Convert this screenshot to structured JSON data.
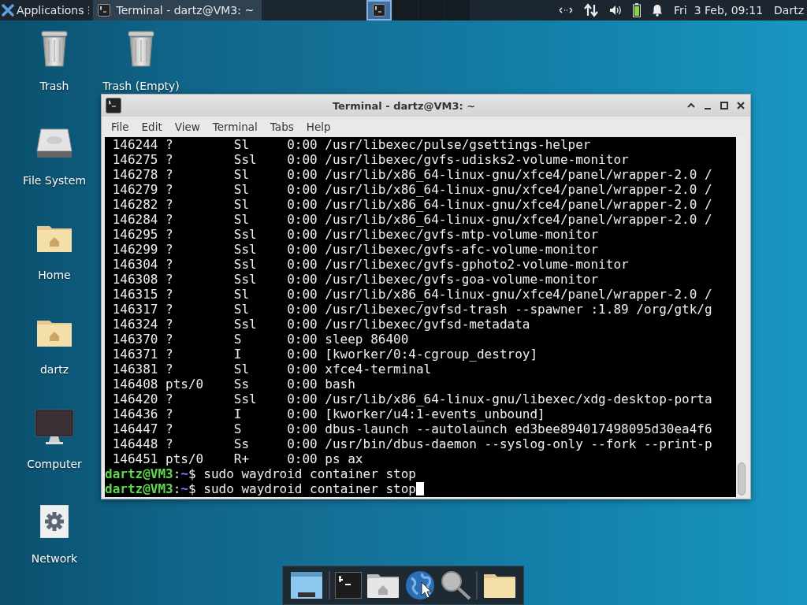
{
  "top_panel": {
    "applications_label": "Applications",
    "tasks": [
      {
        "title": "Terminal - dartz@VM3: ~",
        "selected": true
      }
    ],
    "workspaces": [
      {
        "selected": true
      },
      {
        "selected": false
      },
      {
        "selected": false
      },
      {
        "selected": false
      }
    ],
    "clock": "Fri  3 Feb, 09:11",
    "user": "Dartz"
  },
  "desktop_icons": [
    {
      "label": "Trash",
      "kind": "trash"
    },
    {
      "label": "Trash (Empty)",
      "kind": "trash"
    },
    {
      "label": "File System",
      "kind": "drive"
    },
    {
      "label": "Home",
      "kind": "home-folder"
    },
    {
      "label": "dartz",
      "kind": "home-folder"
    },
    {
      "label": "Computer",
      "kind": "monitor"
    },
    {
      "label": "Network",
      "kind": "gear"
    }
  ],
  "window": {
    "title": "Terminal - dartz@VM3: ~",
    "menu": [
      "File",
      "Edit",
      "View",
      "Terminal",
      "Tabs",
      "Help"
    ],
    "processes": [
      {
        "pid": "146244",
        "tty": "?",
        "stat": "Sl",
        "time": "0:00",
        "command": "/usr/libexec/pulse/gsettings-helper"
      },
      {
        "pid": "146275",
        "tty": "?",
        "stat": "Ssl",
        "time": "0:00",
        "command": "/usr/libexec/gvfs-udisks2-volume-monitor"
      },
      {
        "pid": "146278",
        "tty": "?",
        "stat": "Sl",
        "time": "0:00",
        "command": "/usr/lib/x86_64-linux-gnu/xfce4/panel/wrapper-2.0 /"
      },
      {
        "pid": "146279",
        "tty": "?",
        "stat": "Sl",
        "time": "0:00",
        "command": "/usr/lib/x86_64-linux-gnu/xfce4/panel/wrapper-2.0 /"
      },
      {
        "pid": "146282",
        "tty": "?",
        "stat": "Sl",
        "time": "0:00",
        "command": "/usr/lib/x86_64-linux-gnu/xfce4/panel/wrapper-2.0 /"
      },
      {
        "pid": "146284",
        "tty": "?",
        "stat": "Sl",
        "time": "0:00",
        "command": "/usr/lib/x86_64-linux-gnu/xfce4/panel/wrapper-2.0 /"
      },
      {
        "pid": "146295",
        "tty": "?",
        "stat": "Ssl",
        "time": "0:00",
        "command": "/usr/libexec/gvfs-mtp-volume-monitor"
      },
      {
        "pid": "146299",
        "tty": "?",
        "stat": "Ssl",
        "time": "0:00",
        "command": "/usr/libexec/gvfs-afc-volume-monitor"
      },
      {
        "pid": "146304",
        "tty": "?",
        "stat": "Ssl",
        "time": "0:00",
        "command": "/usr/libexec/gvfs-gphoto2-volume-monitor"
      },
      {
        "pid": "146308",
        "tty": "?",
        "stat": "Ssl",
        "time": "0:00",
        "command": "/usr/libexec/gvfs-goa-volume-monitor"
      },
      {
        "pid": "146315",
        "tty": "?",
        "stat": "Sl",
        "time": "0:00",
        "command": "/usr/lib/x86_64-linux-gnu/xfce4/panel/wrapper-2.0 /"
      },
      {
        "pid": "146317",
        "tty": "?",
        "stat": "Sl",
        "time": "0:00",
        "command": "/usr/libexec/gvfsd-trash --spawner :1.89 /org/gtk/g"
      },
      {
        "pid": "146324",
        "tty": "?",
        "stat": "Ssl",
        "time": "0:00",
        "command": "/usr/libexec/gvfsd-metadata"
      },
      {
        "pid": "146370",
        "tty": "?",
        "stat": "S",
        "time": "0:00",
        "command": "sleep 86400"
      },
      {
        "pid": "146371",
        "tty": "?",
        "stat": "I",
        "time": "0:00",
        "command": "[kworker/0:4-cgroup_destroy]"
      },
      {
        "pid": "146381",
        "tty": "?",
        "stat": "Sl",
        "time": "0:00",
        "command": "xfce4-terminal"
      },
      {
        "pid": "146408",
        "tty": "pts/0",
        "stat": "Ss",
        "time": "0:00",
        "command": "bash"
      },
      {
        "pid": "146420",
        "tty": "?",
        "stat": "Ssl",
        "time": "0:00",
        "command": "/usr/lib/x86_64-linux-gnu/libexec/xdg-desktop-porta"
      },
      {
        "pid": "146436",
        "tty": "?",
        "stat": "I",
        "time": "0:00",
        "command": "[kworker/u4:1-events_unbound]"
      },
      {
        "pid": "146447",
        "tty": "?",
        "stat": "S",
        "time": "0:00",
        "command": "dbus-launch --autolaunch ed3bee894017498095d30ea4f6"
      },
      {
        "pid": "146448",
        "tty": "?",
        "stat": "Ss",
        "time": "0:00",
        "command": "/usr/bin/dbus-daemon --syslog-only --fork --print-p"
      },
      {
        "pid": "146451",
        "tty": "pts/0",
        "stat": "R+",
        "time": "0:00",
        "command": "ps ax"
      }
    ],
    "prompts": [
      {
        "user_host": "dartz@VM3",
        "separator": ":",
        "path": "~",
        "symbol": "$",
        "command": "sudo waydroid container stop",
        "cursor": false
      },
      {
        "user_host": "dartz@VM3",
        "separator": ":",
        "path": "~",
        "symbol": "$",
        "command": "sudo waydroid container stop",
        "cursor": true
      }
    ]
  },
  "dock": {
    "items": [
      {
        "kind": "desktop"
      },
      {
        "kind": "separator"
      },
      {
        "kind": "terminal"
      },
      {
        "kind": "home-folder"
      },
      {
        "kind": "globe"
      },
      {
        "kind": "search"
      },
      {
        "kind": "separator"
      },
      {
        "kind": "folder"
      }
    ]
  }
}
